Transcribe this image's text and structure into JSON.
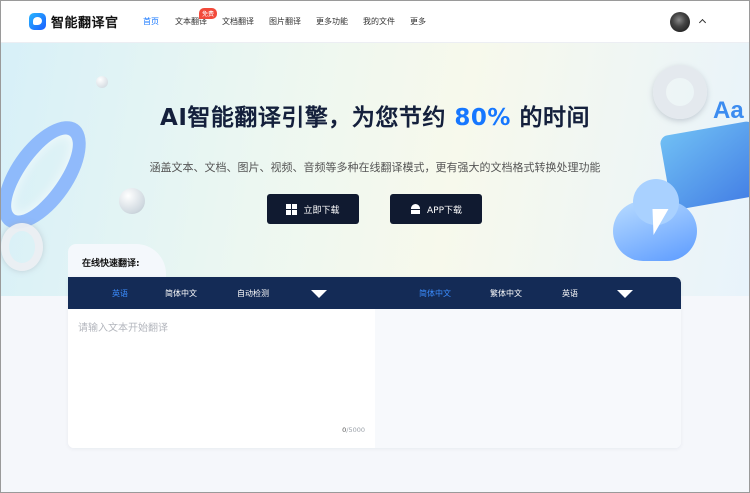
{
  "header": {
    "logo_text": "智能翻译官",
    "nav": [
      {
        "label": "首页",
        "active": true
      },
      {
        "label": "文本翻译",
        "badge": "免费"
      },
      {
        "label": "文档翻译"
      },
      {
        "label": "图片翻译"
      },
      {
        "label": "更多功能"
      },
      {
        "label": "我的文件"
      },
      {
        "label": "更多"
      }
    ]
  },
  "hero": {
    "title_pre": "AI智能翻译引擎，为您节约",
    "title_highlight": "80%",
    "title_post": "的时间",
    "subtitle": "涵盖文本、文档、图片、视频、音频等多种在线翻译模式，更有强大的文档格式转换处理功能",
    "btn_windows": "立即下载",
    "btn_app": "APP下载",
    "deco_text": "Aa"
  },
  "translator": {
    "quick_label": "在线快速翻译:",
    "source_langs": [
      "英语",
      "简体中文",
      "自动检测"
    ],
    "target_langs": [
      "简体中文",
      "繁体中文",
      "英语"
    ],
    "source_active": 0,
    "target_active": 0,
    "placeholder": "请输入文本开始翻译",
    "count_current": "0",
    "count_max": "/5000"
  },
  "colors": {
    "accent": "#1677ff",
    "nav_dark": "#142b56",
    "button_dark": "#101a30",
    "badge_red": "#f24a3b"
  }
}
